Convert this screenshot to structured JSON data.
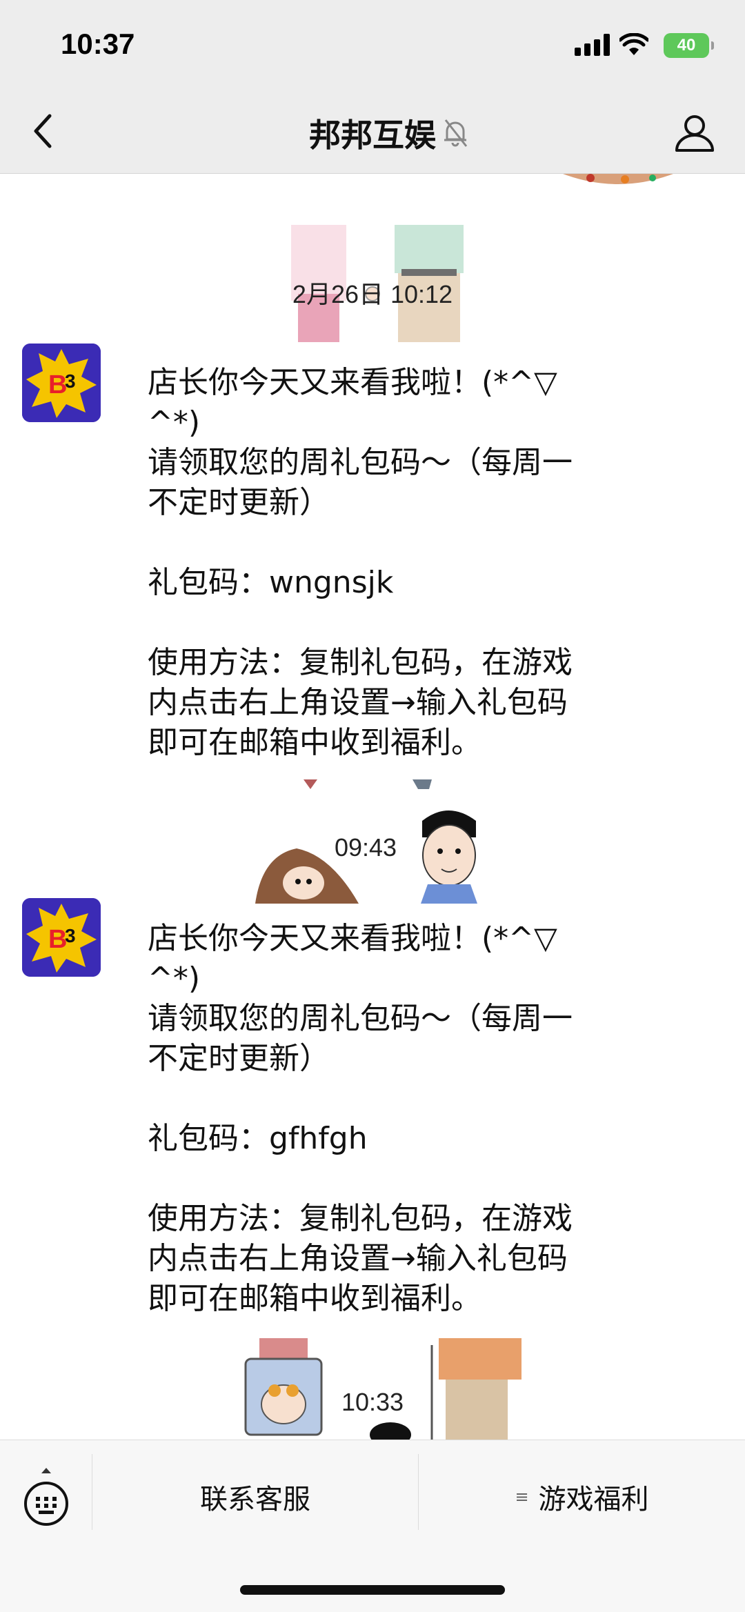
{
  "status_bar": {
    "time": "10:37",
    "battery": "40"
  },
  "nav": {
    "title": "邦邦互娱"
  },
  "chat": {
    "messages": [
      {
        "timestamp": "2月26日 10:12",
        "text": "店长你今天又来看我啦！(*^▽\n^*)\n请领取您的周礼包码～（每周一\n不定时更新）\n\n礼包码：wngnsjk\n\n使用方法：复制礼包码，在游戏\n内点击右上角设置→输入礼包码\n即可在邮箱中收到福利。"
      },
      {
        "timestamp": "09:43",
        "text": "店长你今天又来看我啦！(*^▽\n^*)\n请领取您的周礼包码～（每周一\n不定时更新）\n\n礼包码：gfhfgh\n\n使用方法：复制礼包码，在游戏\n内点击右上角设置→输入礼包码\n即可在邮箱中收到福利。"
      }
    ],
    "last_timestamp": "10:33"
  },
  "bottom_menu": {
    "items": [
      {
        "label": "联系客服"
      },
      {
        "label": "游戏福利",
        "icon": "menu-lines-icon"
      }
    ]
  },
  "colors": {
    "avatar_bg": "#3b2bb5",
    "accent_yellow": "#f5c400",
    "battery_green": "#5ec85a"
  }
}
